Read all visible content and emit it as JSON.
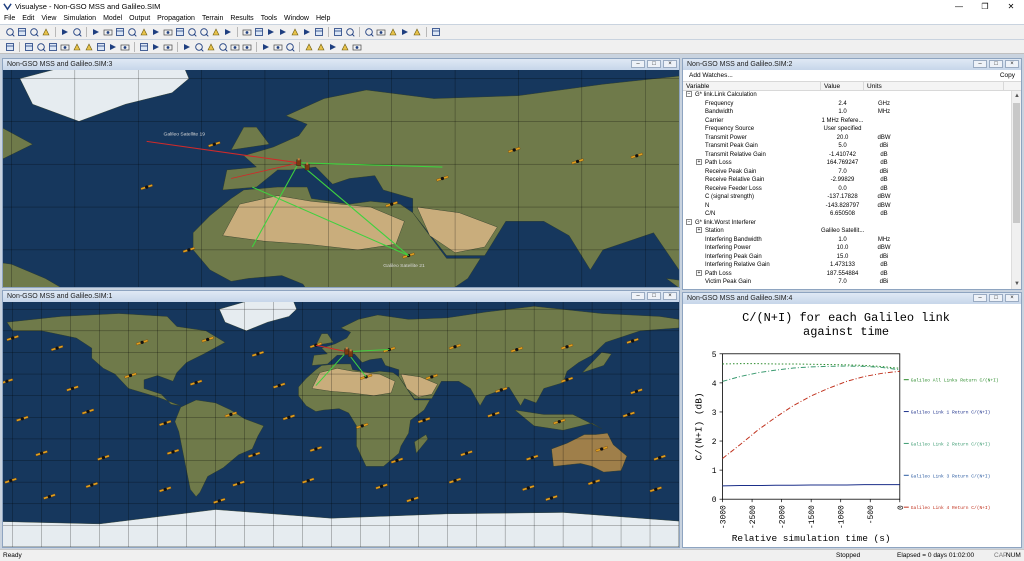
{
  "window": {
    "title": "Visualyse - Non-GSO MSS and Galileo.SIM"
  },
  "menu": [
    "File",
    "Edit",
    "View",
    "Simulation",
    "Model",
    "Output",
    "Propagation",
    "Terrain",
    "Results",
    "Tools",
    "Window",
    "Help"
  ],
  "colors": {
    "accent": "#1f3f80",
    "ocean": "#16375d",
    "land": "#6f7a4a",
    "desert": "#c9ad7c",
    "ice": "#e6ecf0",
    "link_green": "#3fd13f",
    "link_red": "#d02a2a"
  },
  "map3": {
    "caption": "Non-GSO MSS and Galileo.SIM:3",
    "labels": [
      "Galileo Satellite 19",
      "Galileo Satellite 21"
    ]
  },
  "map1": {
    "caption": "Non-GSO MSS and Galileo.SIM:1"
  },
  "watch": {
    "caption": "Non-GSO MSS and Galileo.SIM:2",
    "add_label": "Add Watches...",
    "copy_label": "Copy",
    "headers": [
      "Variable",
      "Value",
      "Units"
    ],
    "rows": [
      {
        "name": "G* link.Link Calculation",
        "value": "",
        "unit": "",
        "level": 0,
        "expander": "minus"
      },
      {
        "name": "Frequency",
        "value": "2.4",
        "unit": "GHz",
        "level": 1
      },
      {
        "name": "Bandwidth",
        "value": "1.0",
        "unit": "MHz",
        "level": 1
      },
      {
        "name": "Carrier",
        "value": "1 MHz Refere...",
        "unit": "",
        "level": 1
      },
      {
        "name": "Frequency Source",
        "value": "User specified",
        "unit": "",
        "level": 1
      },
      {
        "name": "Transmit Power",
        "value": "20.0",
        "unit": "dBW",
        "level": 1
      },
      {
        "name": "Transmit Peak Gain",
        "value": "5.0",
        "unit": "dBi",
        "level": 1
      },
      {
        "name": "Transmit Relative Gain",
        "value": "-1.410742",
        "unit": "dB",
        "level": 1
      },
      {
        "name": "Path Loss",
        "value": "164.769247",
        "unit": "dB",
        "level": 1,
        "expander": "plus"
      },
      {
        "name": "Receive Peak Gain",
        "value": "7.0",
        "unit": "dBi",
        "level": 1
      },
      {
        "name": "Receive Relative Gain",
        "value": "-2.99829",
        "unit": "dB",
        "level": 1
      },
      {
        "name": "Receive Feeder Loss",
        "value": "0.0",
        "unit": "dB",
        "level": 1
      },
      {
        "name": "C (signal strength)",
        "value": "-137.17828",
        "unit": "dBW",
        "level": 1
      },
      {
        "name": "N",
        "value": "-143.828797",
        "unit": "dBW",
        "level": 1
      },
      {
        "name": "C/N",
        "value": "6.650508",
        "unit": "dB",
        "level": 1
      },
      {
        "name": "G* link.Worst Interferer",
        "value": "",
        "unit": "",
        "level": 0,
        "expander": "minus"
      },
      {
        "name": "Station",
        "value": "Galileo Satellit...",
        "unit": "",
        "level": 1,
        "expander": "plus"
      },
      {
        "name": "Interfering Bandwidth",
        "value": "1.0",
        "unit": "MHz",
        "level": 1
      },
      {
        "name": "Interfering Power",
        "value": "10.0",
        "unit": "dBW",
        "level": 1
      },
      {
        "name": "Interfering Peak Gain",
        "value": "15.0",
        "unit": "dBi",
        "level": 1
      },
      {
        "name": "Interfering Relative Gain",
        "value": "1.473133",
        "unit": "dB",
        "level": 1
      },
      {
        "name": "Path Loss",
        "value": "187.554884",
        "unit": "dB",
        "level": 1,
        "expander": "plus"
      },
      {
        "name": "Victim Peak Gain",
        "value": "7.0",
        "unit": "dBi",
        "level": 1
      }
    ]
  },
  "chart_window": {
    "caption": "Non-GSO MSS and Galileo.SIM:4"
  },
  "chart_data": {
    "type": "line",
    "title": "C/(N+I) for each Galileo link against time",
    "title_lines": [
      "C/(N+I) for each Galileo link",
      "against time"
    ],
    "xlabel": "Relative simulation time (s)",
    "ylabel": "C/(N+I) (dB)",
    "xlim": [
      -3000,
      0
    ],
    "ylim": [
      0,
      5
    ],
    "xticks": [
      -3000,
      -2500,
      -2000,
      -1500,
      -1000,
      -500,
      0
    ],
    "yticks": [
      0,
      1,
      2,
      3,
      4,
      5
    ],
    "legend_position": "right",
    "x": [
      -3000,
      -2700,
      -2400,
      -2100,
      -1800,
      -1500,
      -1200,
      -900,
      -600,
      -300,
      0
    ],
    "series": [
      {
        "name": "Galileo All Links Return C/(N+I)",
        "color": "#2a8a2a",
        "dash": "dot",
        "values": [
          4.65,
          4.66,
          4.66,
          4.65,
          4.65,
          4.64,
          4.63,
          4.62,
          4.6,
          4.56,
          4.5
        ]
      },
      {
        "name": "Galileo Link 1 Return C/(N+I)",
        "color": "#1b2f8a",
        "dash": "solid",
        "values": [
          0.46,
          0.47,
          0.47,
          0.48,
          0.48,
          0.49,
          0.49,
          0.49,
          0.5,
          0.5,
          0.5
        ]
      },
      {
        "name": "Galileo Link 2 Return C/(N+I)",
        "color": "#3a9a70",
        "dash": "dashdot",
        "values": [
          4.05,
          4.22,
          4.35,
          4.44,
          4.51,
          4.55,
          4.57,
          4.58,
          4.57,
          4.53,
          4.45
        ]
      },
      {
        "name": "Galileo Link 3 Return C/(N+I)",
        "color": "#2a5aa0",
        "dash": "dash",
        "values": [
          null,
          null,
          null,
          null,
          null,
          null,
          null,
          null,
          null,
          null,
          null
        ]
      },
      {
        "name": "Galileo Link 4 Return C/(N+I)",
        "color": "#c0321e",
        "dash": "dashdot",
        "values": [
          1.4,
          1.88,
          2.38,
          2.82,
          3.22,
          3.55,
          3.82,
          4.05,
          4.22,
          4.33,
          4.4
        ]
      }
    ]
  },
  "status": {
    "ready": "Ready",
    "state": "Stopped",
    "elapsed": "Elapsed = 0 days 01:02:00",
    "cap": "CAP",
    "num": "NUM"
  }
}
